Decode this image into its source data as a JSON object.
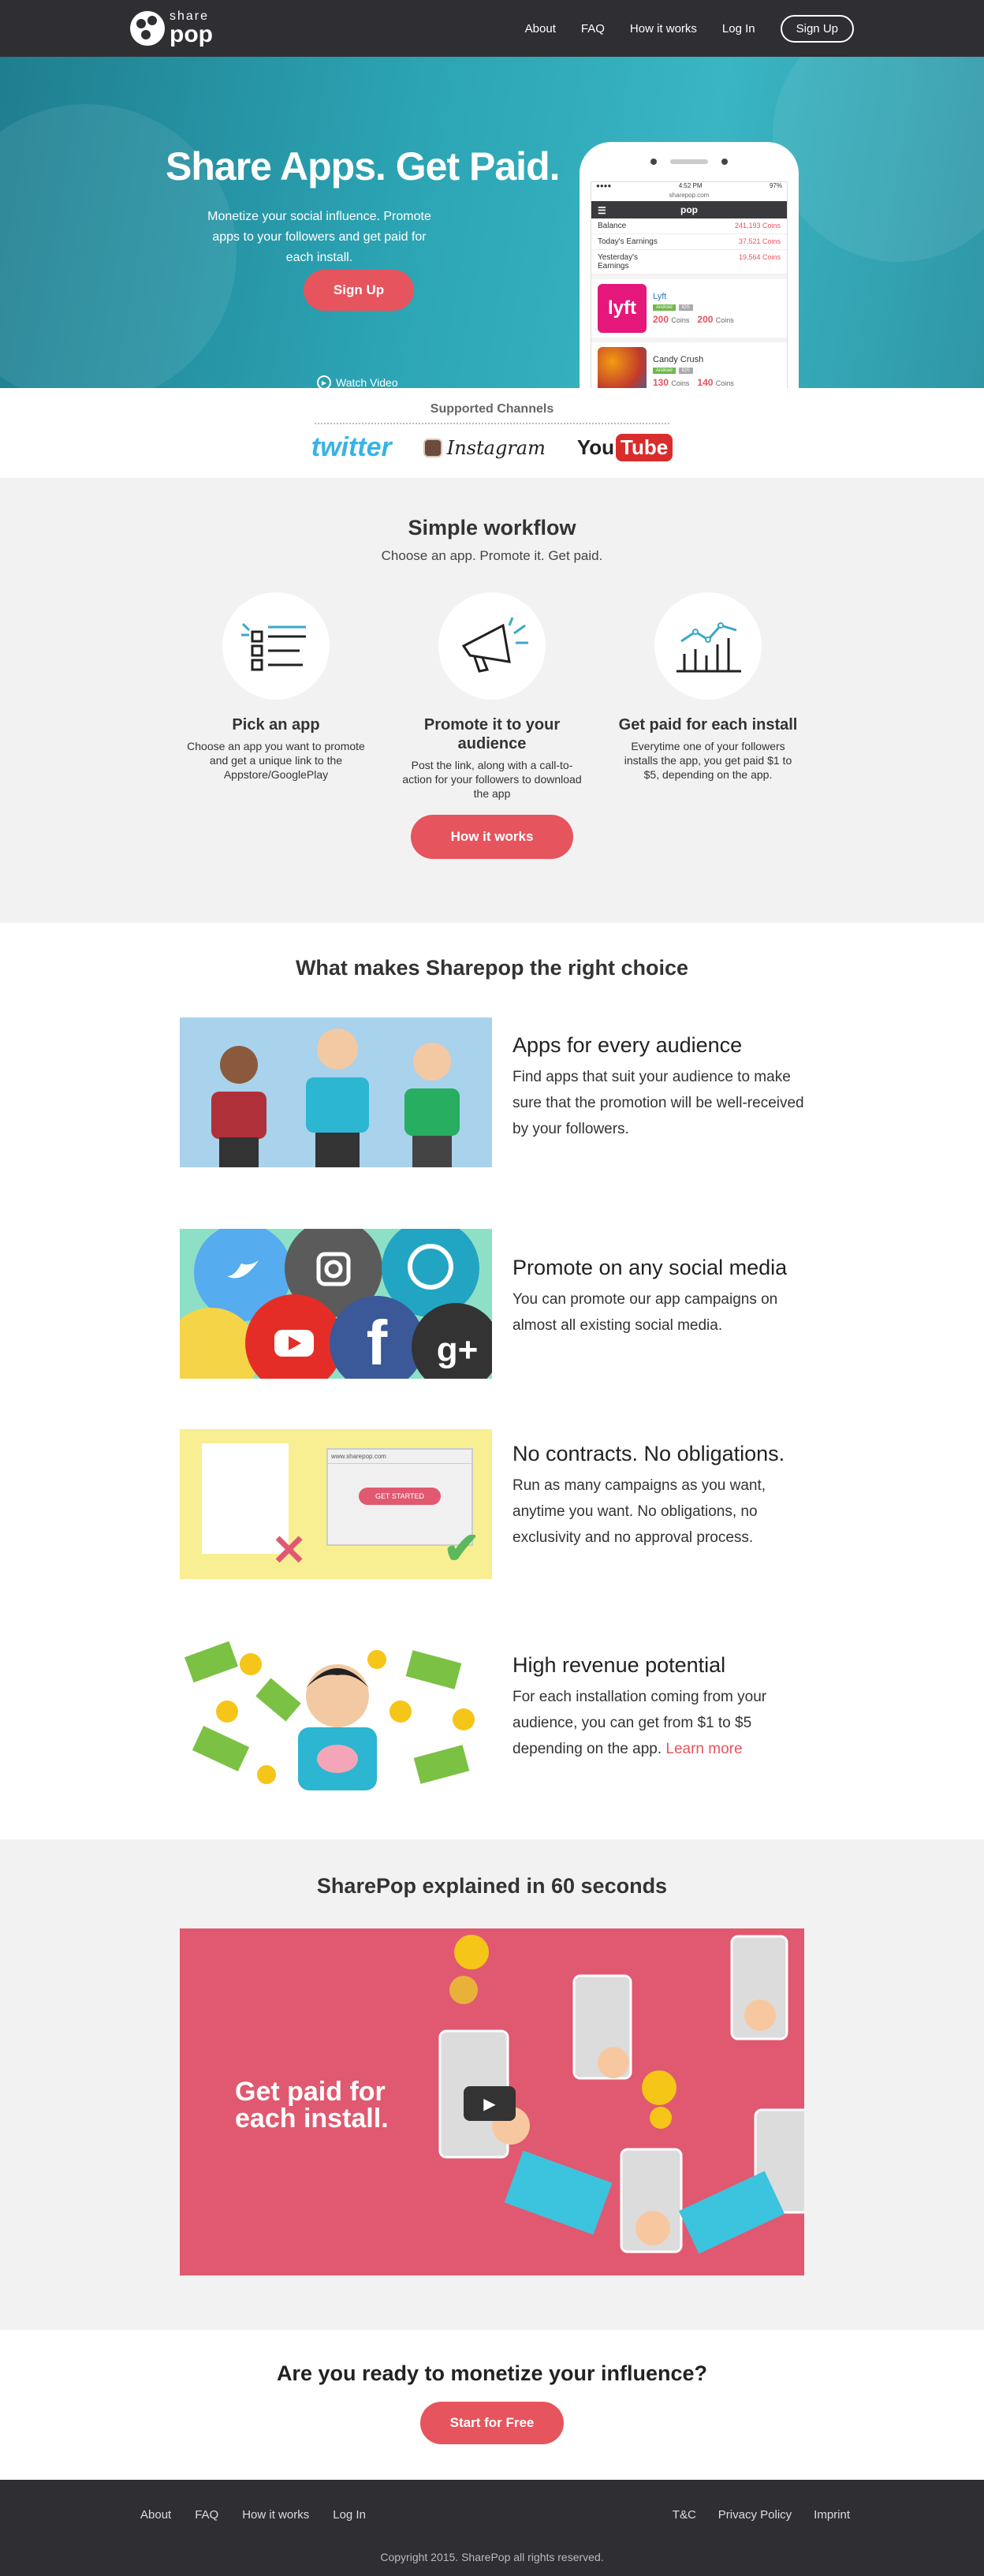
{
  "nav": {
    "logo_top": "share",
    "logo_bottom": "pop",
    "links": [
      "About",
      "FAQ",
      "How it works",
      "Log In"
    ],
    "signup": "Sign Up"
  },
  "hero": {
    "title": "Share Apps. Get Paid.",
    "text": "Monetize your social influence. Promote apps to your followers and get paid for each install.",
    "button": "Sign Up",
    "watch": "Watch Video",
    "phone": {
      "time": "4:52 PM",
      "battery": "97%",
      "url": "sharepop.com",
      "app_name": "pop",
      "rows": [
        {
          "label": "Balance",
          "value": "241,193 Coins"
        },
        {
          "label": "Today's Earnings",
          "value": "37,521 Coins"
        },
        {
          "label": "Yesterday's Earnings",
          "value": "19,564 Coins"
        }
      ],
      "cards": [
        {
          "name": "Lyft",
          "icon": "lyft",
          "color": "#e5177b",
          "tag1": "Android",
          "tag2": "iOS",
          "coins1": "200",
          "coins2": "200",
          "unit": "Coins"
        },
        {
          "name": "Candy Crush",
          "icon": "",
          "color": "#c0392b",
          "tag1": "Android",
          "tag2": "iOS",
          "coins1": "130",
          "coins2": "140",
          "unit": "Coins"
        }
      ]
    }
  },
  "channels": {
    "title": "Supported Channels",
    "twitter": "twitter",
    "instagram": "Instagram",
    "youtube_you": "You",
    "youtube_tube": "Tube"
  },
  "workflow": {
    "title": "Simple workflow",
    "subtitle": "Choose an app. Promote it. Get paid.",
    "steps": [
      {
        "title": "Pick an app",
        "text": "Choose an app you want to promote and get a unique link to the Appstore/GooglePlay"
      },
      {
        "title": "Promote it to your audience",
        "text": "Post the link, along with a call-to-action for your followers to download the app"
      },
      {
        "title": "Get paid for each install",
        "text": "Everytime one of your followers installs the app, you get paid $1 to $5, depending on the app."
      }
    ],
    "button": "How it works"
  },
  "choice": {
    "title": "What makes Sharepop the right choice",
    "features": [
      {
        "title": "Apps for every audience",
        "text": "Find apps that suit your audience to make sure that the promotion will be well-received by your followers."
      },
      {
        "title": "Promote on any social media",
        "text": "You can promote our app campaigns on almost all existing social media."
      },
      {
        "title": "No contracts. No obligations.",
        "text": "Run as many campaigns as you want, anytime you want. No obligations, no exclusivity and no approval process."
      },
      {
        "title": "High revenue potential",
        "text": "For each installation coming from your audience, you can get from $1 to $5 depending on the app.",
        "link": "Learn more"
      }
    ],
    "browser_url": "www.sharepop.com",
    "get_started": "GET STARTED"
  },
  "explained": {
    "title": "SharePop explained in 60 seconds",
    "video_line1": "Get paid for",
    "video_line2": "each install."
  },
  "ready": {
    "title": "Are you ready to monetize your influence?",
    "button": "Start for Free"
  },
  "footer": {
    "left": [
      "About",
      "FAQ",
      "How it works",
      "Log In"
    ],
    "right": [
      "T&C",
      "Privacy Policy",
      "Imprint"
    ],
    "copyright": "Copyright 2015. SharePop all rights reserved."
  },
  "colors": {
    "accent": "#e6545d",
    "dark": "#2f2f33",
    "hero": "#2ba3b3"
  }
}
